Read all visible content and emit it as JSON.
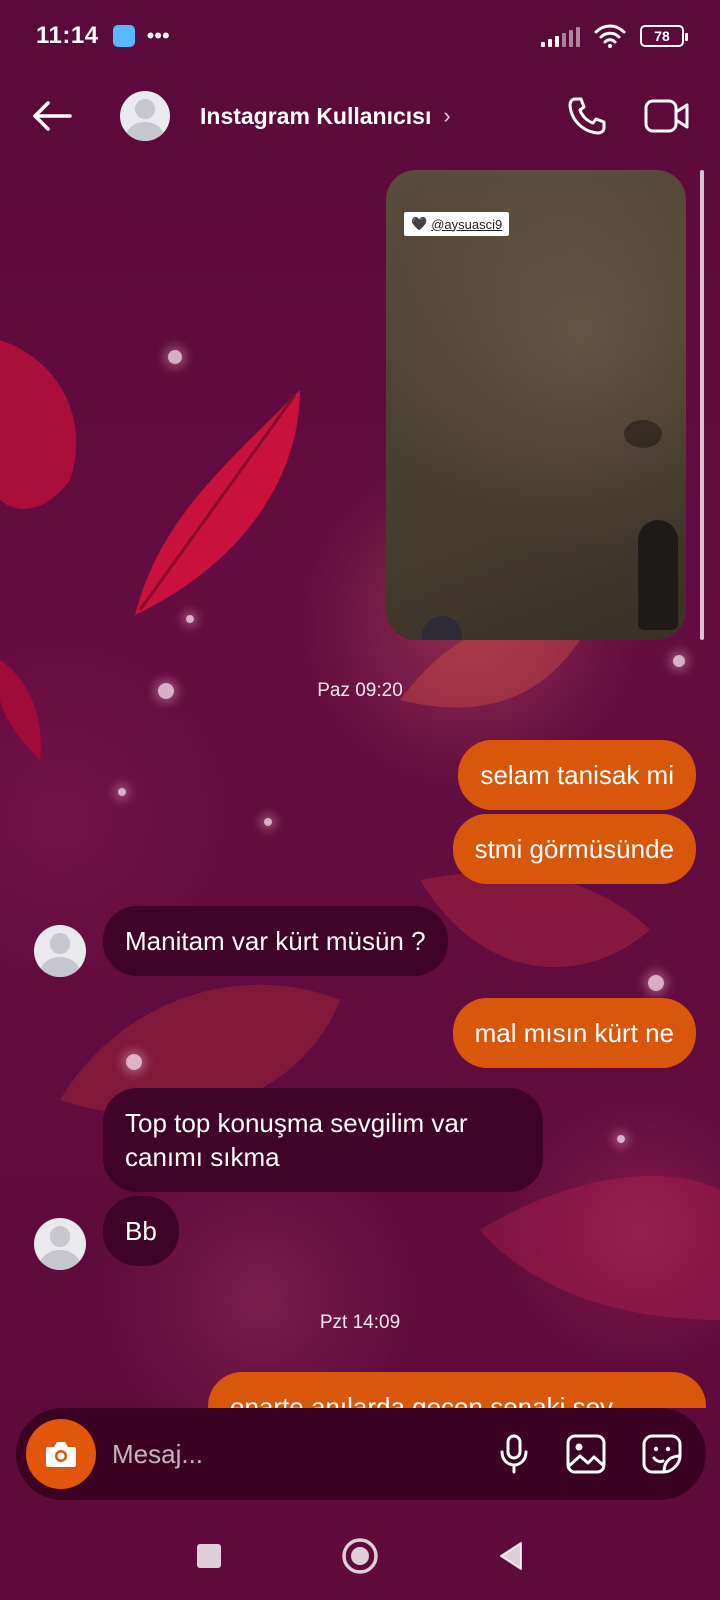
{
  "status_bar": {
    "time": "11:14",
    "overflow": "•••",
    "battery": "78"
  },
  "header": {
    "username": "Instagram Kullanıcısı",
    "chevron": "›"
  },
  "story": {
    "tag_heart": "🖤",
    "tag_handle": "@aysuasci9"
  },
  "messages": {
    "ts1": "Paz 09:20",
    "m1": "selam tanisak mi",
    "m2": "stmi görmüsünde",
    "m3": "Manitam var kürt müsün ?",
    "m4": "mal mısın kürt ne",
    "m5": "Top top konuşma sevgilim var canımı sıkma",
    "m6": "Bb",
    "ts2": "Pzt 14:09",
    "m7": "enarte anılarda gecen senaki sev"
  },
  "composer": {
    "placeholder": "Mesaj..."
  },
  "colors": {
    "outgoing": "#d9570b",
    "incoming": "#3f0228",
    "background": "#5e0a3c"
  }
}
